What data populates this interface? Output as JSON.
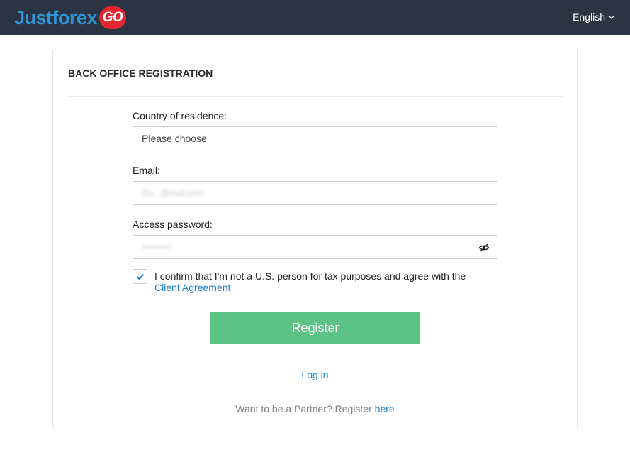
{
  "header": {
    "logo_text": "Justforex",
    "logo_badge": "GO",
    "language": "English",
    "colors": {
      "background": "#2b3442",
      "logo_blue": "#2f97d8",
      "badge_red": "#e3262f"
    }
  },
  "form": {
    "title": "BACK OFFICE REGISTRATION",
    "country": {
      "label": "Country of residence:",
      "value": "Please choose"
    },
    "email": {
      "label": "Email:",
      "value": "f2u...@mail.com"
    },
    "password": {
      "label": "Access password:",
      "value": "••••••••••",
      "icon": "eye-slash-icon"
    },
    "consent": {
      "checked": true,
      "text": "I confirm that I'm not a U.S. person for tax purposes and agree with the",
      "link_text": "Client Agreement"
    },
    "register_label": "Register",
    "login_label": "Log in",
    "partner": {
      "text": "Want to be a Partner? Register",
      "link_text": "here"
    },
    "colors": {
      "register_button": "#5cc286",
      "link": "#1a7fd1"
    }
  }
}
